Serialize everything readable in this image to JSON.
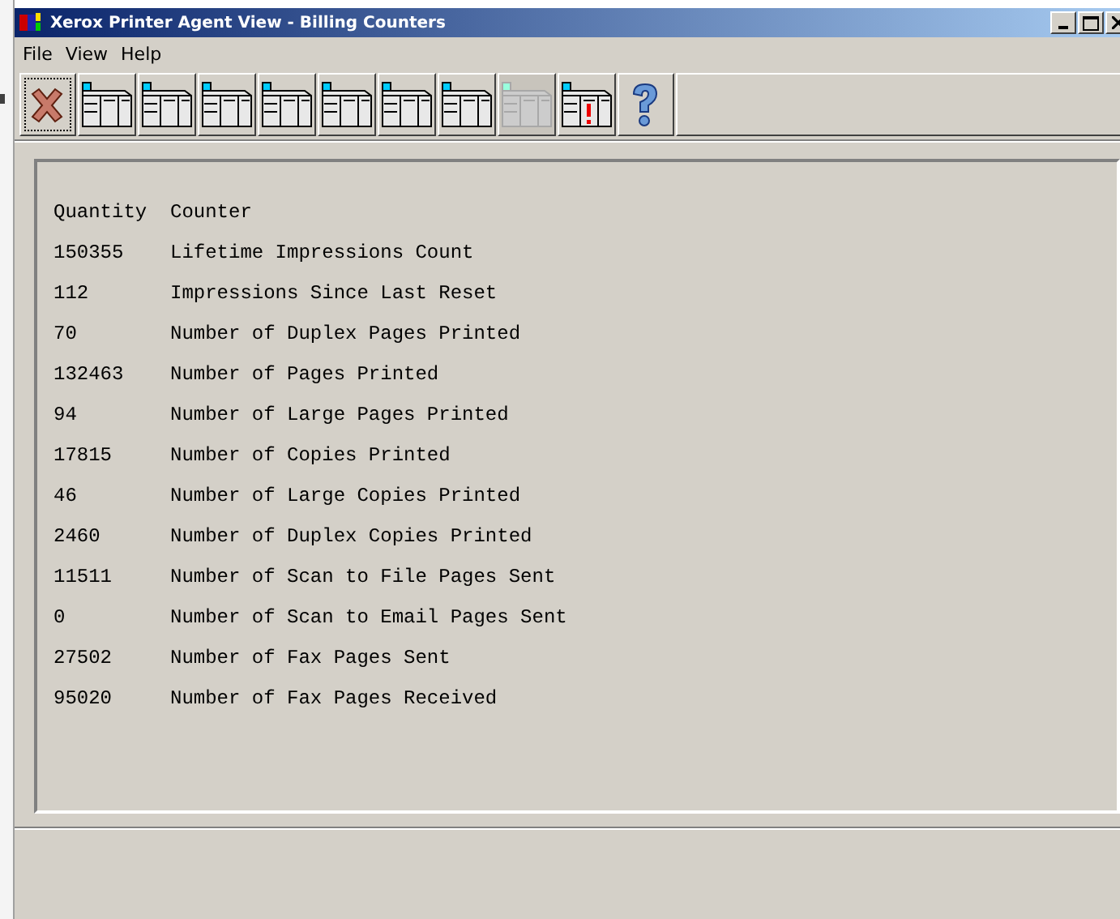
{
  "window": {
    "title": "Xerox Printer Agent View - Billing Counters"
  },
  "menu": [
    {
      "label": "File"
    },
    {
      "label": "View"
    },
    {
      "label": "Help"
    }
  ],
  "toolbar": [
    {
      "kind": "exit",
      "disabled": false,
      "focused": true
    },
    {
      "kind": "printer",
      "disabled": false,
      "focused": false
    },
    {
      "kind": "printer",
      "disabled": false,
      "focused": false
    },
    {
      "kind": "printer",
      "disabled": false,
      "focused": false
    },
    {
      "kind": "printer",
      "disabled": false,
      "focused": false
    },
    {
      "kind": "printer",
      "disabled": false,
      "focused": false
    },
    {
      "kind": "printer",
      "disabled": false,
      "focused": false
    },
    {
      "kind": "printer",
      "disabled": false,
      "focused": false
    },
    {
      "kind": "printer",
      "disabled": true,
      "focused": false
    },
    {
      "kind": "alert",
      "disabled": false,
      "focused": false
    },
    {
      "kind": "help",
      "disabled": false,
      "focused": false
    }
  ],
  "table": {
    "columns": [
      "Quantity",
      "Counter"
    ],
    "rows": [
      [
        "150355",
        "Lifetime Impressions Count"
      ],
      [
        "112",
        "Impressions Since Last Reset"
      ],
      [
        "70",
        "Number of Duplex Pages Printed"
      ],
      [
        "132463",
        "Number of Pages Printed"
      ],
      [
        "94",
        "Number of Large Pages Printed"
      ],
      [
        "17815",
        "Number of Copies Printed"
      ],
      [
        "46",
        "Number of Large Copies Printed"
      ],
      [
        "2460",
        "Number of Duplex Copies Printed"
      ],
      [
        "11511",
        "Number of Scan to File Pages Sent"
      ],
      [
        "0",
        "Number of Scan to Email Pages Sent"
      ],
      [
        "27502",
        "Number of Fax Pages Sent"
      ],
      [
        "95020",
        "Number of Fax Pages Received"
      ]
    ]
  }
}
